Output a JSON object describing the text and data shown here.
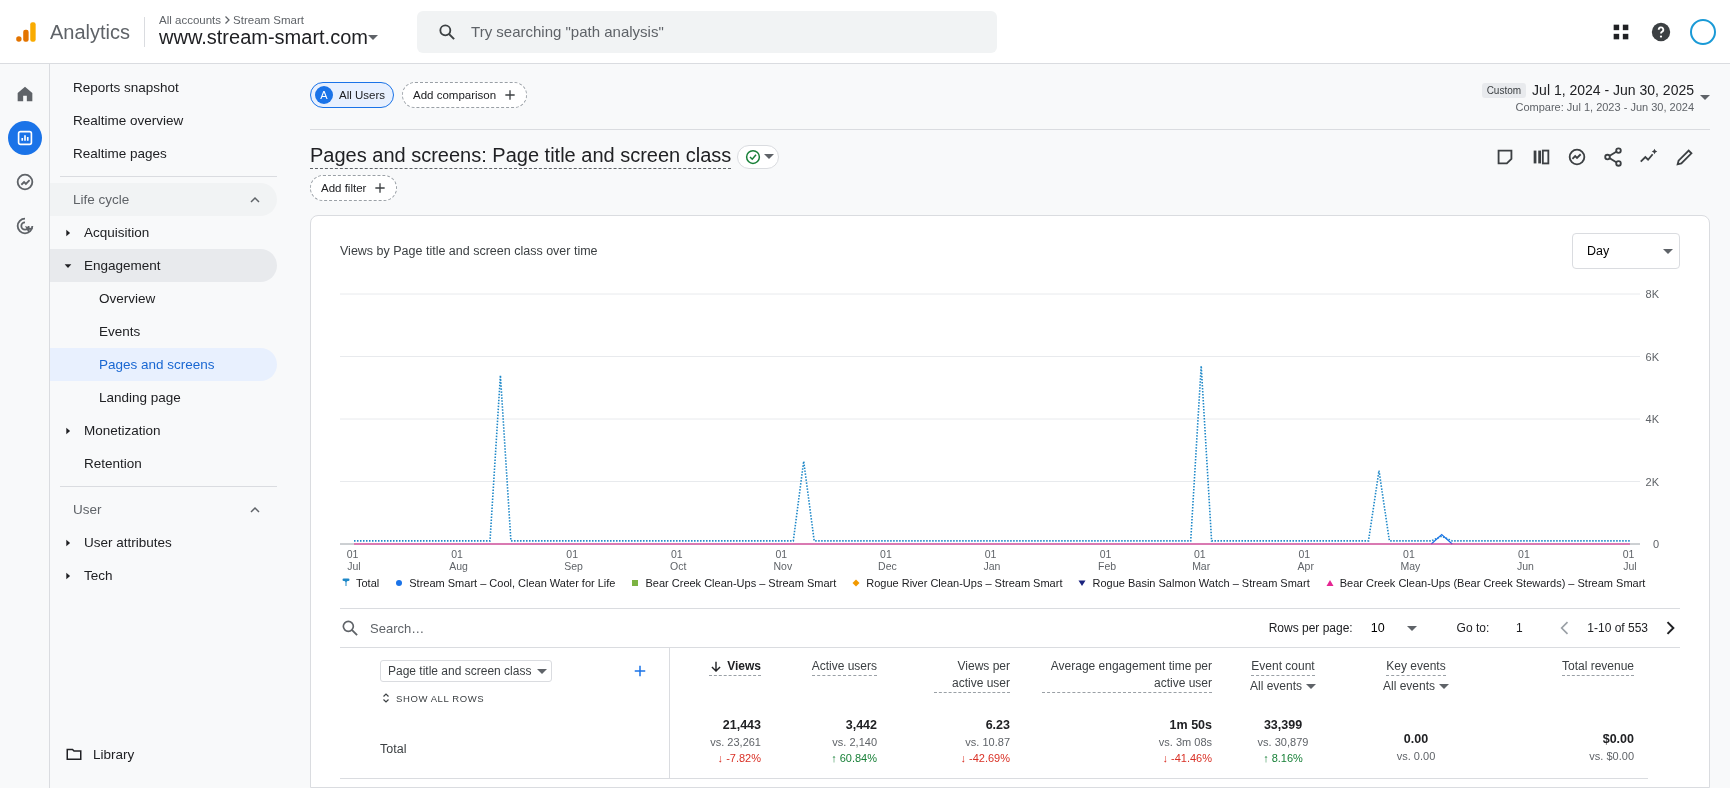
{
  "header": {
    "product": "Analytics",
    "breadcrumb": [
      "All accounts",
      "Stream Smart"
    ],
    "property": "www.stream-smart.com",
    "search": {
      "placeholder": "Try searching \"path analysis\""
    }
  },
  "rail": [
    {
      "selected": false
    },
    {
      "selected": true
    },
    {
      "selected": false
    },
    {
      "selected": false
    }
  ],
  "sidebar": {
    "links": [
      {
        "label": "Reports snapshot",
        "selected": false
      },
      {
        "label": "Realtime overview",
        "selected": false
      },
      {
        "label": "Realtime pages",
        "selected": false
      }
    ],
    "sections": [
      {
        "title": "Life cycle",
        "expanded": true,
        "items": [
          {
            "label": "Acquisition",
            "expanded": false,
            "selected": false
          },
          {
            "label": "Engagement",
            "expanded": true,
            "selected": false,
            "children": [
              {
                "label": "Overview",
                "selected": false
              },
              {
                "label": "Events",
                "selected": false
              },
              {
                "label": "Pages and screens",
                "selected": true
              },
              {
                "label": "Landing page",
                "selected": false
              }
            ]
          },
          {
            "label": "Monetization",
            "expanded": false,
            "selected": false
          },
          {
            "label": "Retention",
            "selected": false
          }
        ]
      },
      {
        "title": "User",
        "expanded": true,
        "items": [
          {
            "label": "User attributes",
            "expanded": false,
            "selected": false
          },
          {
            "label": "Tech",
            "expanded": false,
            "selected": false
          }
        ]
      }
    ],
    "footer": "Library"
  },
  "comparisons": {
    "segment_letter": "A",
    "segment": "All Users",
    "add": "Add comparison"
  },
  "date_range": {
    "kind": "Custom",
    "range": "Jul 1, 2024 - Jun 30, 2025",
    "compare": "Compare: Jul 1, 2023 - Jun 30, 2024"
  },
  "report": {
    "title": "Pages and screens: Page title and screen class",
    "add_filter": "Add filter"
  },
  "chart": {
    "title": "Views by Page title and screen class over time",
    "interval": "Day",
    "chart_data": {
      "type": "line",
      "ylim": [
        0,
        8000
      ],
      "grid": true,
      "categories": [
        "01 Jul",
        null,
        null,
        null,
        null,
        null,
        null,
        null,
        null,
        null,
        "01 Aug",
        null,
        null,
        null,
        null,
        null,
        null,
        null,
        null,
        null,
        null,
        "01 Sep",
        null,
        null,
        null,
        null,
        null,
        null,
        null,
        null,
        null,
        "01 Oct",
        null,
        null,
        null,
        null,
        null,
        null,
        null,
        null,
        null,
        "01 Nov",
        null,
        null,
        null,
        null,
        null,
        null,
        null,
        null,
        null,
        "01 Dec",
        null,
        null,
        null,
        null,
        null,
        null,
        null,
        null,
        null,
        "01 Jan",
        null,
        null,
        null,
        null,
        null,
        null,
        null,
        null,
        null,
        null,
        "01 Feb",
        null,
        null,
        null,
        null,
        null,
        null,
        null,
        null,
        "01 Mar",
        null,
        null,
        null,
        null,
        null,
        null,
        null,
        null,
        null,
        "01 Apr",
        null,
        null,
        null,
        null,
        null,
        null,
        null,
        null,
        null,
        "01 May",
        null,
        null,
        null,
        null,
        null,
        null,
        null,
        null,
        null,
        null,
        "01 Jun",
        null,
        null,
        null,
        null,
        null,
        null,
        null,
        null,
        null,
        "01 Jul"
      ],
      "yticks": [
        {
          "value": 0,
          "label": "0"
        },
        {
          "value": 2000,
          "label": "2K"
        },
        {
          "value": 4000,
          "label": "4K"
        },
        {
          "value": 6000,
          "label": "6K"
        },
        {
          "value": 8000,
          "label": "8K"
        }
      ],
      "series": [
        {
          "name": "Total",
          "color": "#1e88c8",
          "line_style": "dotted",
          "values": [
            100,
            100,
            100,
            100,
            100,
            100,
            100,
            100,
            100,
            100,
            100,
            100,
            100,
            100,
            5400,
            100,
            100,
            100,
            100,
            100,
            100,
            100,
            100,
            100,
            100,
            100,
            100,
            100,
            100,
            100,
            100,
            100,
            100,
            100,
            100,
            100,
            100,
            100,
            100,
            100,
            100,
            100,
            100,
            2650,
            100,
            100,
            100,
            100,
            100,
            100,
            100,
            100,
            100,
            100,
            100,
            100,
            100,
            100,
            100,
            100,
            100,
            100,
            100,
            100,
            100,
            100,
            100,
            100,
            100,
            100,
            100,
            100,
            100,
            100,
            100,
            100,
            100,
            100,
            100,
            100,
            100,
            5700,
            100,
            100,
            100,
            100,
            100,
            100,
            100,
            100,
            100,
            100,
            100,
            100,
            100,
            100,
            100,
            100,
            2350,
            100,
            100,
            100,
            100,
            100,
            250,
            100,
            100,
            100,
            100,
            100,
            100,
            100,
            100,
            100,
            100,
            100,
            100,
            100,
            100,
            100,
            100,
            100,
            100
          ]
        },
        {
          "name": "Stream Smart – Cool, Clean Water for Life",
          "color": "#1a73e8",
          "values": [
            null,
            null,
            null,
            null,
            null,
            null,
            null,
            null,
            null,
            null,
            null,
            null,
            null,
            null,
            null,
            null,
            null,
            null,
            null,
            null,
            null,
            null,
            null,
            null,
            null,
            null,
            null,
            null,
            null,
            null,
            null,
            null,
            null,
            null,
            null,
            null,
            null,
            null,
            null,
            null,
            null,
            null,
            null,
            null,
            null,
            null,
            null,
            null,
            null,
            null,
            null,
            null,
            null,
            null,
            null,
            null,
            null,
            null,
            null,
            null,
            null,
            null,
            null,
            null,
            null,
            null,
            null,
            null,
            null,
            null,
            null,
            null,
            null,
            null,
            null,
            null,
            null,
            null,
            null,
            null,
            null,
            null,
            null,
            null,
            null,
            null,
            null,
            null,
            null,
            null,
            null,
            null,
            null,
            null,
            null,
            null,
            null,
            null,
            null,
            null,
            null,
            null,
            null,
            0,
            300,
            0,
            null,
            null,
            null,
            null,
            null,
            null,
            null,
            null,
            null,
            null,
            null,
            null,
            null,
            null,
            null,
            null,
            null
          ]
        },
        {
          "name": "Bear Creek Clean-Ups – Stream Smart",
          "color": "#7cb342",
          "values": [
            null,
            null,
            null,
            null,
            null,
            null,
            null,
            null,
            null,
            null,
            null,
            null,
            null,
            null,
            null,
            null,
            null,
            null,
            null,
            null,
            null,
            null,
            null,
            null,
            null,
            null,
            null,
            null,
            null,
            null,
            null,
            null,
            null,
            null,
            null,
            null,
            null,
            null,
            null,
            null,
            null,
            null,
            null,
            null,
            null,
            null,
            null,
            null,
            null,
            null,
            null,
            null,
            null,
            null,
            null,
            null,
            null,
            null,
            null,
            null,
            null,
            null,
            null,
            null,
            null,
            null,
            null,
            null,
            null,
            null,
            null,
            null,
            null,
            null,
            null,
            null,
            null,
            null,
            null,
            null,
            null,
            null,
            null,
            null,
            null,
            null,
            null,
            null,
            null,
            null,
            null,
            null,
            null,
            null,
            null,
            null,
            null,
            null,
            null,
            null,
            null,
            null,
            null,
            null,
            null,
            null,
            null,
            null,
            null,
            null,
            null,
            null,
            null,
            null,
            null,
            null,
            null,
            null,
            null,
            null,
            null,
            null,
            null
          ]
        },
        {
          "name": "Rogue River Clean-Ups – Stream Smart",
          "color": "#f29900",
          "values": [
            null,
            null,
            null,
            null,
            null,
            null,
            null,
            null,
            null,
            null,
            null,
            null,
            null,
            null,
            null,
            null,
            null,
            null,
            null,
            null,
            null,
            null,
            null,
            null,
            null,
            null,
            null,
            null,
            null,
            null,
            null,
            null,
            null,
            null,
            null,
            null,
            null,
            null,
            null,
            null,
            null,
            null,
            null,
            null,
            null,
            null,
            null,
            null,
            null,
            null,
            null,
            null,
            null,
            null,
            null,
            null,
            null,
            null,
            null,
            null,
            null,
            null,
            null,
            null,
            null,
            null,
            null,
            null,
            null,
            null,
            null,
            null,
            null,
            null,
            null,
            null,
            null,
            null,
            null,
            null,
            null,
            null,
            null,
            null,
            null,
            null,
            null,
            null,
            null,
            null,
            null,
            null,
            null,
            null,
            null,
            null,
            null,
            null,
            null,
            null,
            null,
            null,
            null,
            null,
            null,
            null,
            null,
            null,
            null,
            null,
            null,
            null,
            null,
            null,
            null,
            null,
            null,
            null,
            null,
            null,
            null,
            null,
            null
          ]
        },
        {
          "name": "Rogue Basin Salmon Watch – Stream Smart",
          "color": "#1a237e",
          "values": [
            null,
            null,
            null,
            null,
            null,
            null,
            null,
            null,
            null,
            null,
            null,
            null,
            null,
            null,
            null,
            null,
            null,
            null,
            null,
            null,
            null,
            null,
            null,
            null,
            null,
            null,
            null,
            null,
            null,
            null,
            null,
            null,
            null,
            null,
            null,
            null,
            null,
            null,
            null,
            null,
            null,
            null,
            null,
            null,
            null,
            null,
            null,
            null,
            null,
            null,
            null,
            null,
            null,
            null,
            null,
            null,
            null,
            null,
            null,
            null,
            null,
            null,
            null,
            null,
            null,
            null,
            null,
            null,
            null,
            null,
            null,
            null,
            null,
            null,
            null,
            null,
            null,
            null,
            null,
            null,
            null,
            null,
            null,
            null,
            null,
            null,
            null,
            null,
            null,
            null,
            null,
            null,
            null,
            null,
            null,
            null,
            null,
            null,
            null,
            null,
            null,
            null,
            null,
            null,
            null,
            null,
            null,
            null,
            null,
            null,
            null,
            null,
            null,
            null,
            null,
            null,
            null,
            null,
            null,
            null,
            null,
            null,
            null
          ]
        },
        {
          "name": "Bear Creek Clean-Ups (Bear Creek Stewards) – Stream Smart",
          "color": "#e52592",
          "values": [
            0,
            0,
            0,
            0,
            0,
            0,
            0,
            0,
            0,
            0,
            0,
            0,
            0,
            0,
            0,
            0,
            0,
            0,
            0,
            0,
            0,
            0,
            0,
            0,
            0,
            0,
            0,
            0,
            0,
            0,
            0,
            0,
            0,
            0,
            0,
            0,
            0,
            0,
            0,
            0,
            0,
            0,
            0,
            0,
            0,
            0,
            0,
            0,
            0,
            0,
            0,
            0,
            0,
            0,
            0,
            0,
            0,
            0,
            0,
            0,
            0,
            0,
            0,
            0,
            0,
            0,
            0,
            0,
            0,
            0,
            0,
            0,
            0,
            0,
            0,
            0,
            0,
            0,
            0,
            0,
            0,
            0,
            0,
            0,
            0,
            0,
            0,
            0,
            0,
            0,
            0,
            0,
            0,
            0,
            0,
            0,
            0,
            0,
            0,
            0,
            0,
            0,
            0,
            0,
            0,
            0,
            0,
            0,
            0,
            0,
            0,
            0,
            0,
            0,
            0,
            0,
            0,
            0,
            0,
            0,
            0,
            0,
            0
          ]
        }
      ]
    }
  },
  "table": {
    "search": {
      "placeholder": "Search…"
    },
    "rows_per_page_label": "Rows per page:",
    "rows_per_page": "10",
    "goto_label": "Go to:",
    "goto": "1",
    "range": "1-10 of 553",
    "dimension": "Page title and screen class",
    "show_all_rows": "SHOW ALL ROWS",
    "columns": [
      {
        "label": "Views",
        "sorted": true
      },
      {
        "label": "Active users",
        "sorted": false
      },
      {
        "label": "Views per active user",
        "sorted": false
      },
      {
        "label": "Average engagement time per active user",
        "sorted": false
      },
      {
        "label": "Event count",
        "sorted": false,
        "filter": "All events"
      },
      {
        "label": "Key events",
        "sorted": false,
        "filter": "All events"
      },
      {
        "label": "Total revenue",
        "sorted": false
      }
    ],
    "total": {
      "label": "Total",
      "cells": [
        {
          "value": "21,443",
          "compare": "vs. 23,261",
          "change": "↓ -7.82%",
          "positive": false
        },
        {
          "value": "3,442",
          "compare": "vs. 2,140",
          "change": "↑ 60.84%",
          "positive": true
        },
        {
          "value": "6.23",
          "compare": "vs. 10.87",
          "change": "↓ -42.69%",
          "positive": false
        },
        {
          "value": "1m 50s",
          "compare": "vs. 3m 08s",
          "change": "↓ -41.46%",
          "positive": false
        },
        {
          "value": "33,399",
          "compare": "vs. 30,879",
          "change": "↑ 8.16%",
          "positive": true
        },
        {
          "value": "0.00",
          "compare": "vs. 0.00"
        },
        {
          "value": "$0.00",
          "compare": "vs. $0.00"
        }
      ]
    }
  }
}
